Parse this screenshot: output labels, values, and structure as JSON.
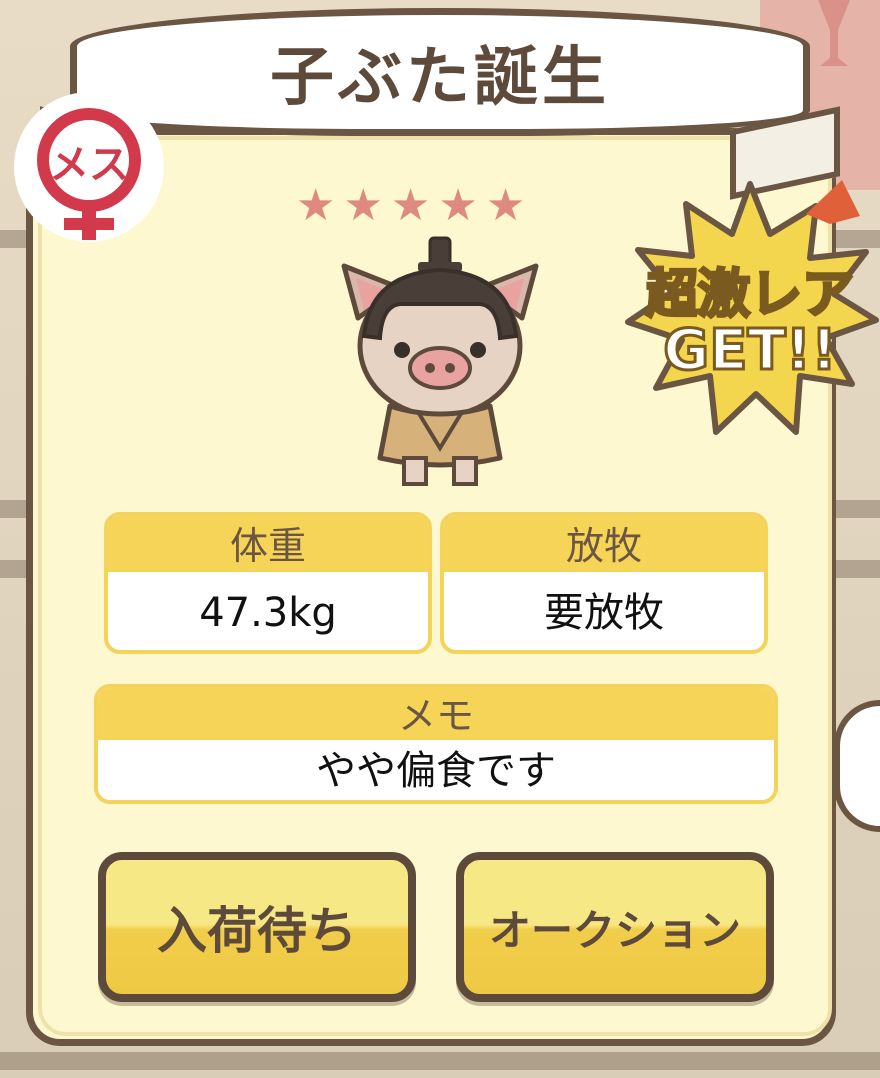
{
  "header": {
    "title": "子ぶた誕生"
  },
  "gender_badge": {
    "label": "メス"
  },
  "rarity": {
    "stars": 5,
    "star_glyph": "★",
    "star_color": "#df8a80"
  },
  "rare_burst": {
    "line1": "超激レア",
    "line2": "GET!!"
  },
  "stats": {
    "weight": {
      "label": "体重",
      "value": "47.3kg"
    },
    "grazing": {
      "label": "放牧",
      "value": "要放牧"
    },
    "memo": {
      "label": "メモ",
      "value": "やや偏食です"
    }
  },
  "actions": {
    "restock_label": "入荷待ち",
    "auction_label": "オークション"
  },
  "colors": {
    "frame": "#6b5643",
    "card": "#fdf8d0",
    "accent_yellow": "#f6d458",
    "female_red": "#d23a4b"
  }
}
